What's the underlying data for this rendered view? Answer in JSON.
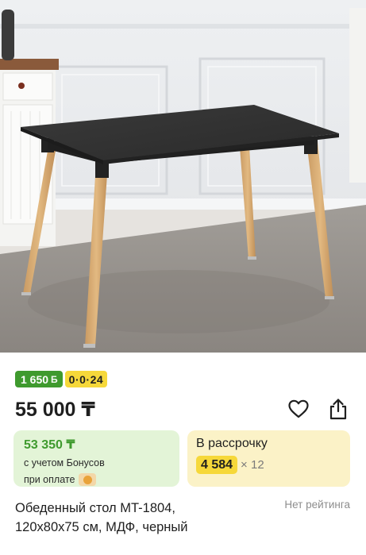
{
  "product": {
    "image_alt": "Обеденный стол MT-1804",
    "bonus_badge": "1 650",
    "bonus_badge_icon": "Б",
    "installment_badge": "0·0·24",
    "price": "55 000 ₸",
    "name_line1": "Обеденный стол MT-1804,",
    "name_line2": "120x80x75 см, МДФ, черный",
    "rating": "Нет рейтинга"
  },
  "bonus_card": {
    "amount": "53 350 ₸",
    "line1": "с учетом Бонусов",
    "line2": "при оплате"
  },
  "installment_card": {
    "title": "В рассрочку",
    "monthly": "4 584",
    "multiplier": "× 12"
  },
  "colors": {
    "bonus_green": "#3f9a2e",
    "bonus_card_bg": "#e3f4d7",
    "installment_yellow": "#f6d83a",
    "installment_card_bg": "#fbf2c7"
  },
  "icons": [
    "heart-icon",
    "share-icon",
    "kaspi-pay-icon"
  ]
}
